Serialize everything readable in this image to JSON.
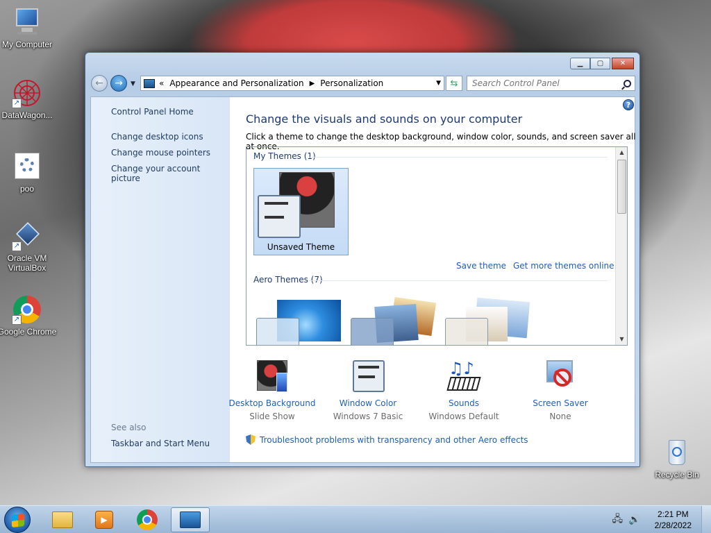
{
  "desktop": {
    "icons": [
      {
        "label": "My Computer"
      },
      {
        "label": "DataWagon..."
      },
      {
        "label": "poo"
      },
      {
        "label": "Oracle VM VirtualBox"
      },
      {
        "label": "Google Chrome"
      },
      {
        "label": "Recycle Bin"
      }
    ]
  },
  "window": {
    "address": {
      "prefix": "«",
      "crumbs": [
        "Appearance and Personalization",
        "Personalization"
      ],
      "separator": "▶"
    },
    "search_placeholder": "Search Control Panel",
    "left_pane": {
      "home": "Control Panel Home",
      "links": [
        "Change desktop icons",
        "Change mouse pointers",
        "Change your account picture"
      ],
      "see_also": "See also",
      "see_also_links": [
        "Taskbar and Start Menu"
      ]
    },
    "main": {
      "title": "Change the visuals and sounds on your computer",
      "subtitle": "Click a theme to change the desktop background, window color, sounds, and screen saver all at once.",
      "my_themes": "My Themes (1)",
      "selected_theme": "Unsaved Theme",
      "save_theme": "Save theme",
      "get_more": "Get more themes online",
      "aero_themes": "Aero Themes (7)"
    },
    "bottom": [
      {
        "label": "Desktop Background",
        "sub": "Slide Show"
      },
      {
        "label": "Window Color",
        "sub": "Windows 7 Basic"
      },
      {
        "label": "Sounds",
        "sub": "Windows Default"
      },
      {
        "label": "Screen Saver",
        "sub": "None"
      }
    ],
    "troubleshoot": "Troubleshoot problems with transparency and other Aero effects"
  },
  "taskbar": {
    "time": "2:21 PM",
    "date": "2/28/2022"
  },
  "colors": {
    "link": "#1e5fb4",
    "title": "#1e3a6e"
  }
}
